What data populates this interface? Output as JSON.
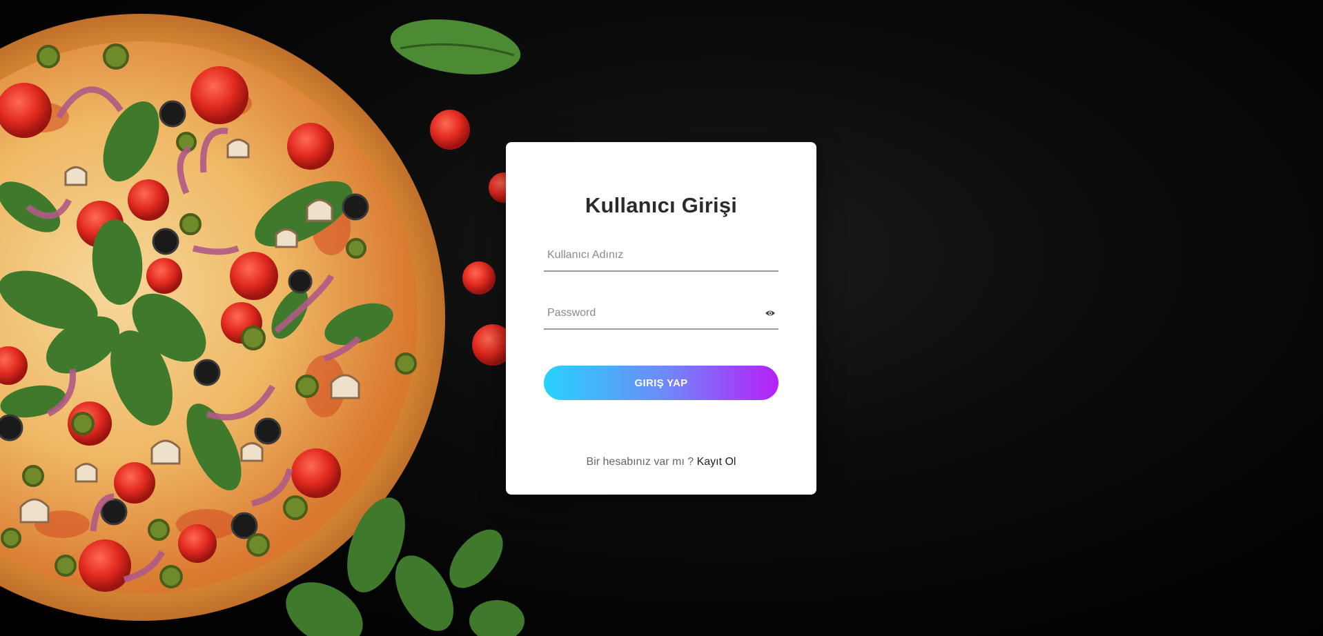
{
  "login": {
    "title": "Kullanıcı Girişi",
    "username_placeholder": "Kullanıcı Adınız",
    "username_value": "",
    "password_placeholder": "Password",
    "password_value": "",
    "submit_label": "GIRIŞ YAP",
    "signup_prompt": "Bir hesabınız var mı ?",
    "signup_link": "Kayıt Ol"
  },
  "icons": {
    "password_toggle": "eye-icon"
  },
  "colors": {
    "button_gradient_start": "#27d3fc",
    "button_gradient_end": "#b521f7",
    "card_background": "#ffffff",
    "page_background": "#070707"
  }
}
